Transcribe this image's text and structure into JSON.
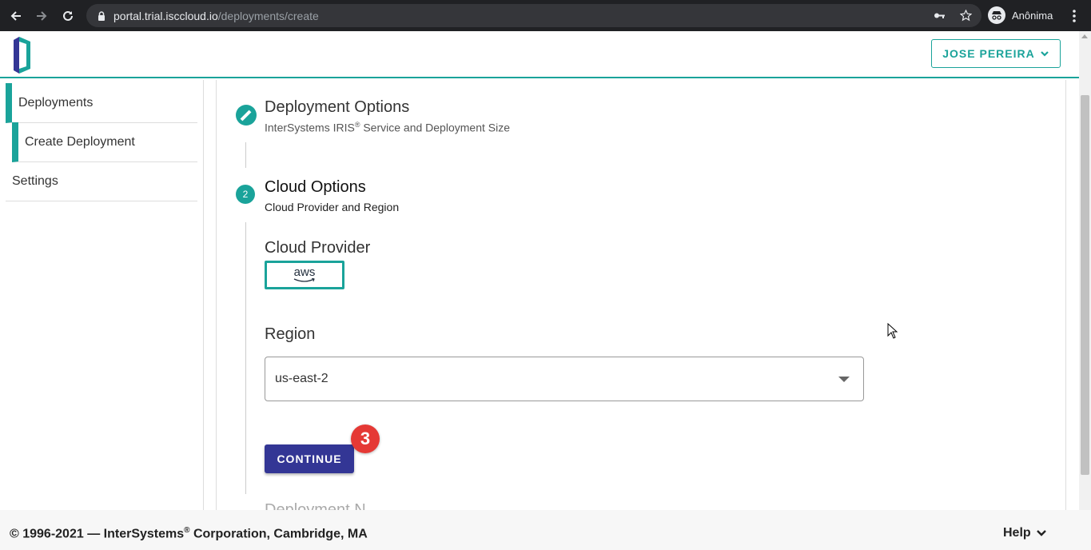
{
  "browser": {
    "url_host": "portal.trial.isccloud.io",
    "url_path": "/deployments/create",
    "profile_label": "Anônima"
  },
  "header": {
    "user_button_label": "JOSE PEREIRA"
  },
  "sidebar": {
    "items": [
      {
        "label": "Deployments"
      },
      {
        "label": "Create Deployment"
      },
      {
        "label": "Settings"
      }
    ]
  },
  "steps": {
    "step1": {
      "title": "Deployment Options",
      "subtitle_pre": "InterSystems IRIS",
      "subtitle_sup": "®",
      "subtitle_post": " Service and Deployment Size"
    },
    "step2": {
      "number": "2",
      "title": "Cloud Options",
      "subtitle": "Cloud Provider and Region"
    },
    "next_step_title_partial": "Deployment N"
  },
  "form": {
    "cloud_provider_label": "Cloud Provider",
    "cloud_provider_selected": "aws",
    "region_label": "Region",
    "region_value": "us-east-2",
    "continue_label": "CONTINUE",
    "annotation_badge": "3"
  },
  "footer": {
    "copyright_pre": "© 1996-2021 — InterSystems",
    "copyright_sup": "®",
    "copyright_post": " Corporation, Cambridge, MA",
    "help_label": "Help"
  },
  "colors": {
    "accent": "#1aa39a",
    "primary_button": "#333695",
    "badge": "#e53935"
  }
}
